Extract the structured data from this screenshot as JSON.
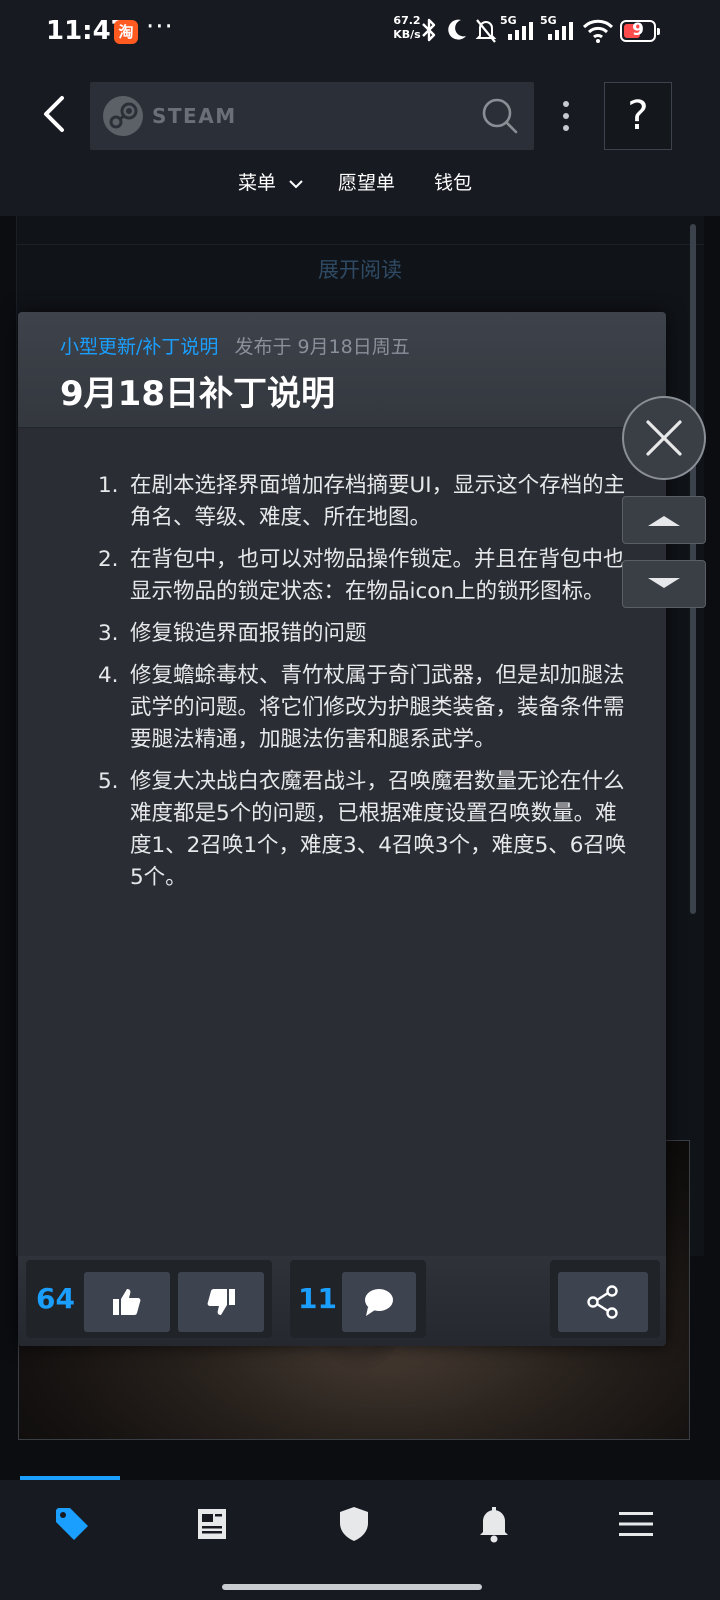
{
  "status_bar": {
    "time": "11:47",
    "app_badge": "淘",
    "more_dots": "···",
    "net_speed_value": "67.2",
    "net_speed_unit": "KB/s",
    "signal_1_label": "5G",
    "signal_2_label": "5G",
    "battery_level": "9",
    "icons": [
      "bluetooth-icon",
      "moon-icon",
      "mute-bell-icon",
      "signal-icon",
      "signal-icon",
      "wifi-icon",
      "battery-icon"
    ]
  },
  "header": {
    "search_logo_text": "STEAM",
    "help_label": "?",
    "nav": {
      "menu_label": "菜单",
      "wishlist_label": "愿望单",
      "wallet_label": "钱包"
    }
  },
  "background": {
    "expand_label": "展开阅读"
  },
  "modal": {
    "category": "小型更新/补丁说明",
    "published": "发布于 9月18日周五",
    "title": "9月18日补丁说明",
    "notes": [
      {
        "num": "1.",
        "text": "在剧本选择界面增加存档摘要UI，显示这个存档的主角名、等级、难度、所在地图。"
      },
      {
        "num": "2.",
        "text": "在背包中，也可以对物品操作锁定。并且在背包中也显示物品的锁定状态：在物品icon上的锁形图标。"
      },
      {
        "num": "3.",
        "text": "修复锻造界面报错的问题"
      },
      {
        "num": "4.",
        "text": "修复蟾蜍毒杖、青竹杖属于奇门武器，但是却加腿法武学的问题。将它们修改为护腿类装备，装备条件需要腿法精通，加腿法伤害和腿系武学。"
      },
      {
        "num": "5.",
        "text": "修复大决战白衣魔君战斗，召唤魔君数量无论在什么难度都是5个的问题，已根据难度设置召唤数量。难度1、2召唤1个，难度3、4召唤3个，难度5、6召唤5个。"
      }
    ],
    "votes_up": "64",
    "comments": "11"
  },
  "colors": {
    "accent": "#1a9fff",
    "header_bg": "#171a21",
    "modal_bg": "#2a2d34"
  },
  "bottom_nav": [
    "tag-icon",
    "news-icon",
    "shield-icon",
    "bell-icon",
    "menu-icon"
  ]
}
